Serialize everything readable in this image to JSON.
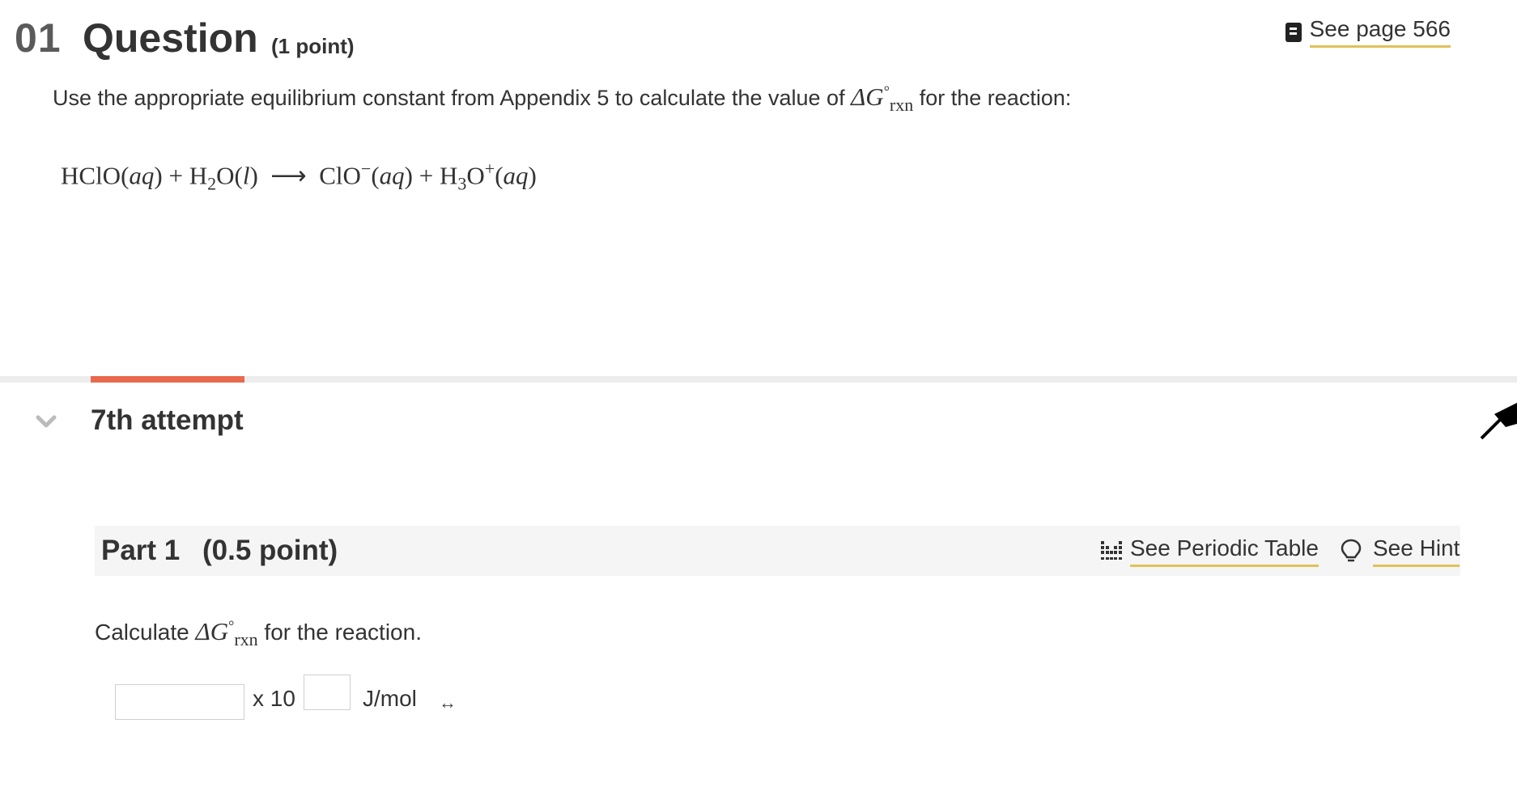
{
  "question": {
    "number": "01",
    "title": "Question",
    "points": "(1 point)",
    "see_page_label": "See page 566",
    "prompt_prefix": "Use the appropriate equilibrium constant from Appendix 5 to calculate the value of",
    "prompt_suffix": "for the reaction:",
    "delta_g_symbol": "ΔG",
    "delta_g_sup": "°",
    "delta_g_sub": "rxn",
    "reaction": {
      "r1": "HClO",
      "r1_state": "aq",
      "r2_a": "H",
      "r2_sub": "2",
      "r2_b": "O",
      "r2_state": "l",
      "arrow": "⟶",
      "p1": "ClO",
      "p1_charge": "−",
      "p1_state": "aq",
      "p2_a": "H",
      "p2_sub": "3",
      "p2_b": "O",
      "p2_charge": "+",
      "p2_state": "aq"
    }
  },
  "attempt": {
    "label": "7th attempt"
  },
  "part": {
    "label": "Part 1",
    "points": "(0.5 point)",
    "periodic_table_label": "See Periodic Table",
    "hint_label": "See Hint",
    "instruction_prefix": "Calculate",
    "instruction_suffix": "for the reaction.",
    "answer": {
      "mantissa_value": "",
      "times_ten": "x 10",
      "exponent_value": "",
      "unit": "J/mol",
      "unit_toggle_icon": "left-right-arrow-icon"
    }
  },
  "colors": {
    "progress": "#e8694d",
    "link_underline": "#e0c15a"
  }
}
